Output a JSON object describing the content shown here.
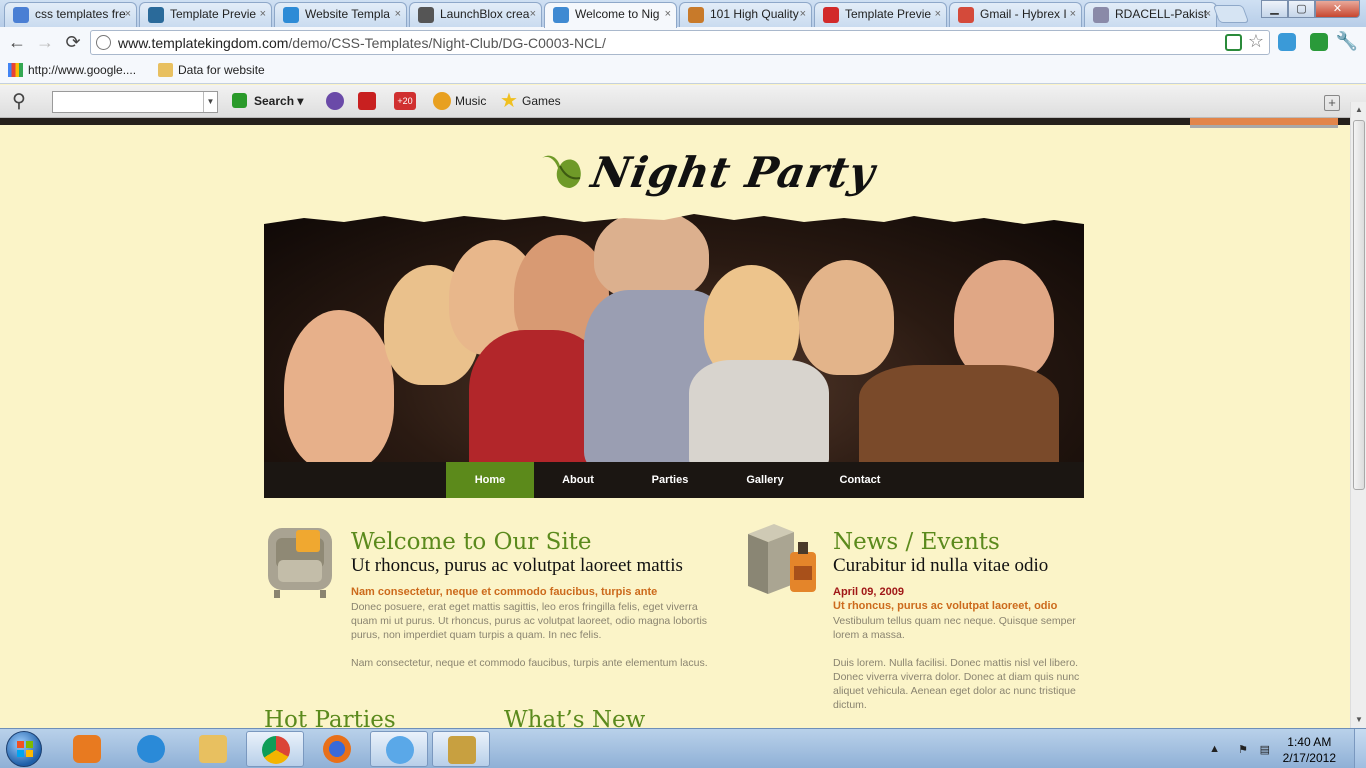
{
  "browser": {
    "tabs": [
      {
        "title": "css templates fre",
        "color": "#4a7fd4"
      },
      {
        "title": "Template Previe",
        "color": "#2a6a9a"
      },
      {
        "title": "Website Templa",
        "color": "#2d8bd6"
      },
      {
        "title": "LaunchBlox crea",
        "color": "#555555"
      },
      {
        "title": "Welcome to Nig",
        "color": "#3f8ad2",
        "active": true
      },
      {
        "title": "101 High Quality",
        "color": "#c87a2a"
      },
      {
        "title": "Template Previe",
        "color": "#d22a2a"
      },
      {
        "title": "Gmail - Hybrex I",
        "color": "#d44a3a"
      },
      {
        "title": "RDACELL-Pakist",
        "color": "#8a8aa8"
      }
    ],
    "tab_close_glyph": "×",
    "url_host": "www.templatekingdom.com",
    "url_path": "/demo/CSS-Templates/Night-Club/DG-C0003-NCL/",
    "back_glyph": "←",
    "forward_glyph": "→",
    "reload_glyph": "⟳",
    "bookmarks": [
      {
        "label": "http://www.google....",
        "icon": "google-icon"
      },
      {
        "label": "Data for website",
        "icon": "folder-icon"
      }
    ]
  },
  "addon_toolbar": {
    "search_label": "Search",
    "items": [
      {
        "label": "Music",
        "icon": "music-icon",
        "color": "#e8a020"
      },
      {
        "label": "Games",
        "icon": "star-icon",
        "color": "#f0c020"
      }
    ],
    "badge": "+20"
  },
  "site": {
    "logo_text": "Night Party",
    "nav": [
      "Home",
      "About",
      "Parties",
      "Gallery",
      "Contact"
    ],
    "active_nav": "Home",
    "accent_green": "#5b8a1d",
    "welcome": {
      "title": "Welcome to Our Site",
      "subtitle": "Ut rhoncus, purus ac volutpat laoreet mattis",
      "lead": "Nam consectetur, neque et commodo faucibus, turpis ante",
      "para1": "Donec posuere, erat eget mattis sagittis, leo eros fringilla felis, eget viverra quam mi ut purus. Ut rhoncus, purus ac volutpat laoreet, odio magna lobortis purus, non imperdiet quam turpis a quam. In nec felis.",
      "para2": "Nam consectetur, neque et commodo faucibus, turpis ante elementum lacus."
    },
    "news": {
      "title": "News / Events",
      "subtitle": "Curabitur id nulla vitae odio",
      "date": "April 09, 2009",
      "lead": "Ut rhoncus, purus ac volutpat laoreet, odio",
      "para1": "Vestibulum tellus quam nec neque. Quisque semper lorem a massa.",
      "para2": "Duis lorem. Nulla facilisi. Donec mattis nisl vel libero. Donec viverra viverra dolor. Donec at diam quis nunc aliquet vehicula. Aenean eget dolor ac nunc tristique dictum."
    },
    "section_hot": "Hot Parties",
    "section_new": "What’s New"
  },
  "taskbar": {
    "time": "1:40 AM",
    "date": "2/17/2012"
  }
}
